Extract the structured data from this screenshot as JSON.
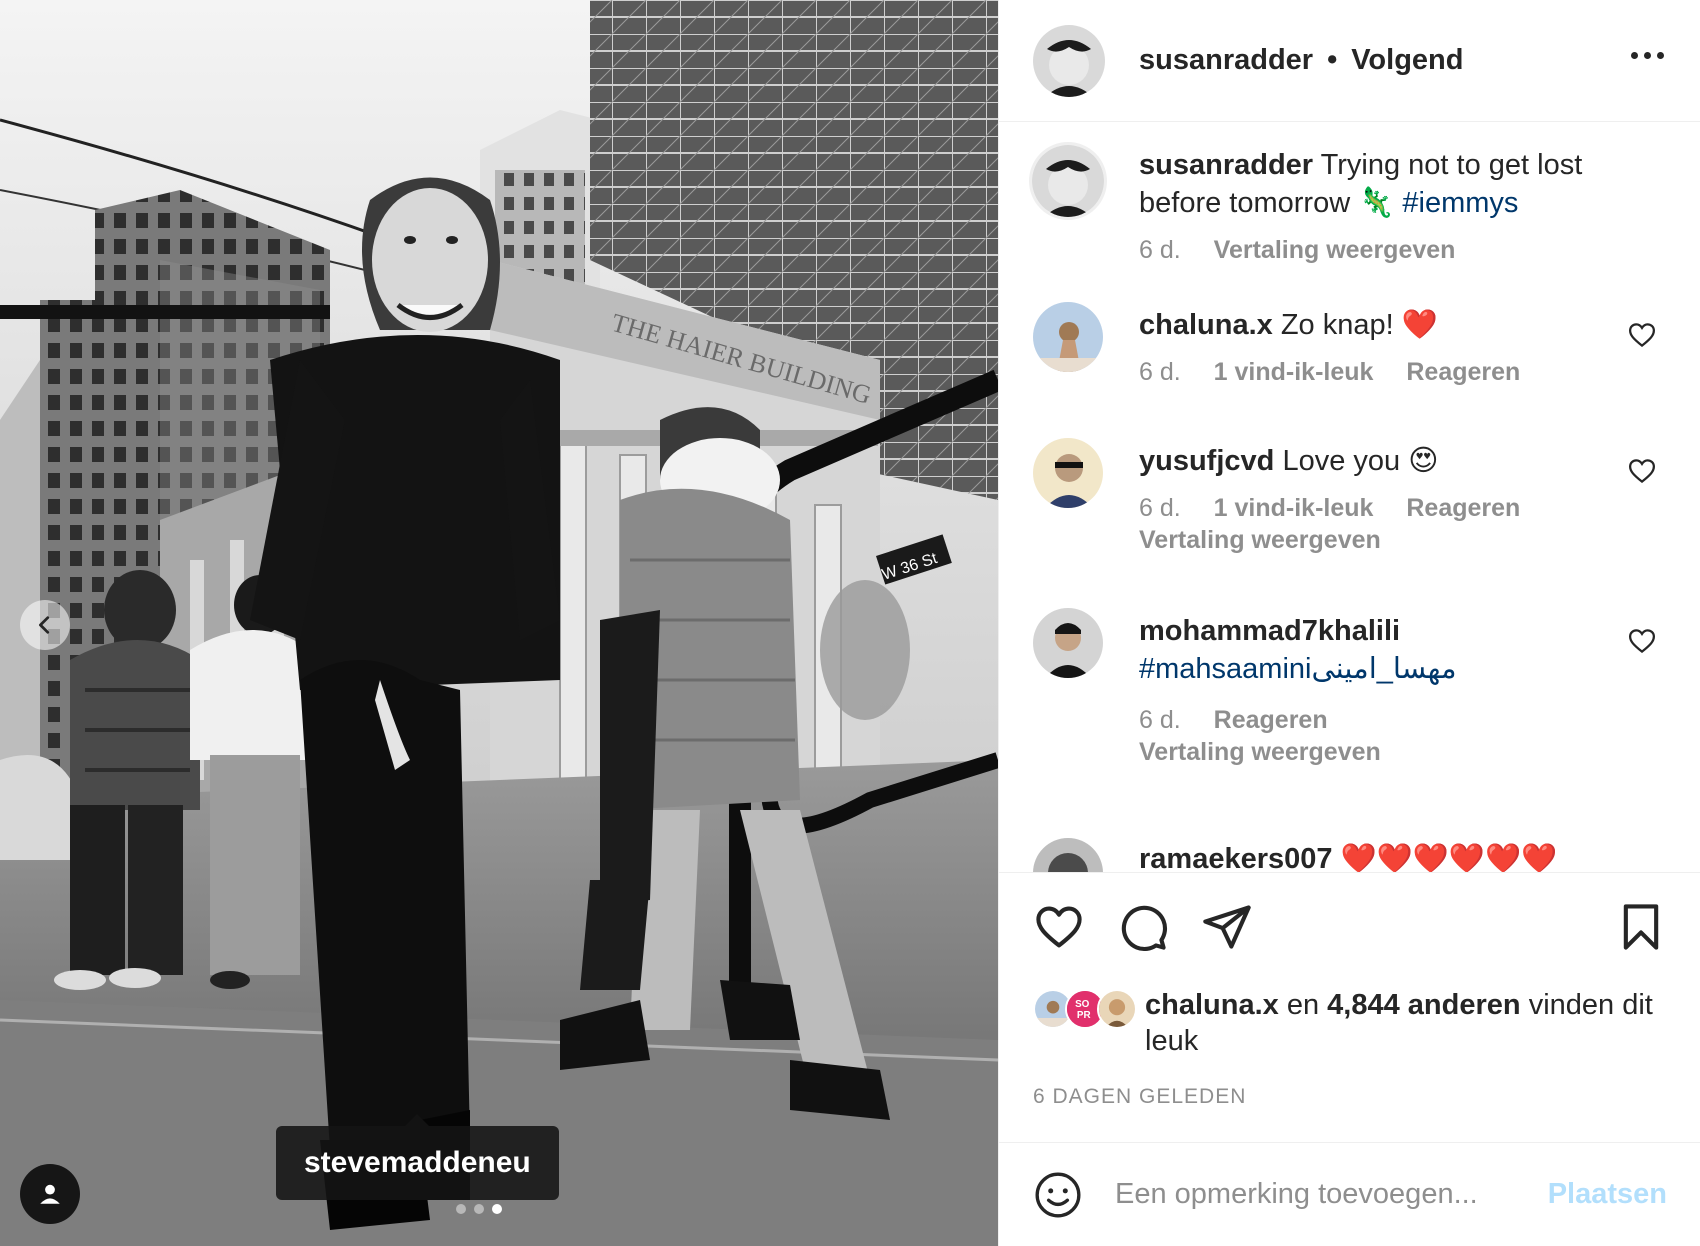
{
  "post": {
    "username": "susanradder",
    "separator": "•",
    "follow_status": "Volgend",
    "more_icon": "more-horizontal-icon"
  },
  "photo": {
    "description_icon": "photo",
    "building_sign": "THE HAIER BUILDING",
    "street_sign": "W 36 St",
    "tag_label": "stevemaddeneu",
    "carousel_dots": 3,
    "active_dot": 3
  },
  "caption": {
    "username": "susanradder",
    "text": "Trying not to get lost before tomorrow 🦎",
    "hashtag": "#iemmys",
    "time": "6 d.",
    "translate": "Vertaling weergeven"
  },
  "comments": [
    {
      "username": "chaluna.x",
      "text": "Zo knap!",
      "emoji": "❤️",
      "time": "6 d.",
      "likes": "1 vind-ik-leuk",
      "reply": "Reageren",
      "translate": ""
    },
    {
      "username": "yusufjcvd",
      "text": "Love you",
      "emoji": "😍",
      "time": "6 d.",
      "likes": "1 vind-ik-leuk",
      "reply": "Reageren",
      "translate": "Vertaling weergeven"
    },
    {
      "username": "mohammad7khalili",
      "text": "#mahsaamini",
      "text_rtl": "مهسا_امینی",
      "time": "6 d.",
      "likes": "",
      "reply": "Reageren",
      "translate": "Vertaling weergeven"
    },
    {
      "username": "ramaekers007",
      "text": "❤️❤️❤️❤️❤️❤️"
    }
  ],
  "actions": {
    "like_icon": "heart-icon",
    "comment_icon": "comment-icon",
    "share_icon": "paper-plane-icon",
    "save_icon": "bookmark-icon"
  },
  "likes": {
    "first_user": "chaluna.x",
    "connector": "en",
    "others": "4,844 anderen",
    "suffix": "vinden dit leuk"
  },
  "timestamp": "6 DAGEN GELEDEN",
  "composer": {
    "placeholder": "Een opmerking toevoegen...",
    "post_label": "Plaatsen"
  },
  "colors": {
    "link": "#00376b",
    "muted": "#8e8e8e",
    "post_disabled": "#b2dffc",
    "heart_red": "#ed4956"
  }
}
